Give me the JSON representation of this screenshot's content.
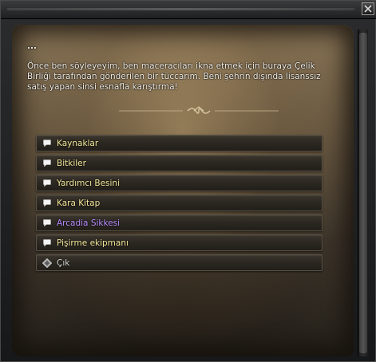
{
  "dialog": {
    "ellipsis": "...",
    "body": "Önce ben söyleyeyim, ben maceracıları ikna etmek için buraya Çelik Birliği tarafından gönderilen bir tüccarım. Beni şehrin dışında lisanssız satış yapan sinsi esnafla karıştırma!"
  },
  "options": [
    {
      "label": "Kaynaklar",
      "icon": "speech-bubble-icon",
      "color": "#f3e79a"
    },
    {
      "label": "Bitkiler",
      "icon": "speech-bubble-icon",
      "color": "#f3e79a"
    },
    {
      "label": "Yardımcı Besini",
      "icon": "speech-bubble-icon",
      "color": "#f3e79a"
    },
    {
      "label": "Kara Kitap",
      "icon": "speech-bubble-icon",
      "color": "#f3e79a"
    },
    {
      "label": "Arcadia Sikkesi",
      "icon": "speech-bubble-icon",
      "color": "#b98cff"
    },
    {
      "label": "Pişirme ekipmanı",
      "icon": "speech-bubble-icon",
      "color": "#f3e79a"
    },
    {
      "label": "Çık",
      "icon": "diamond-exit-icon",
      "color": "#d8d8d8"
    }
  ],
  "window": {
    "close_icon": "close-x-icon"
  }
}
